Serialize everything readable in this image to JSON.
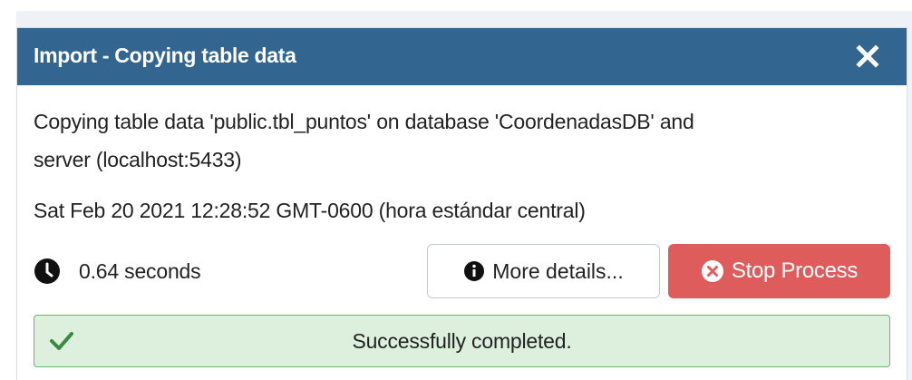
{
  "dialog": {
    "title": "Import - Copying table data",
    "close_icon": "close-icon",
    "header_color": "#326690"
  },
  "message": {
    "line1": "Copying table data 'public.tbl_puntos' on database 'CoordenadasDB' and",
    "line2": "server (localhost:5433)"
  },
  "timestamp": "Sat Feb 20 2021 12:28:52 GMT-0600 (hora estándar central)",
  "timer": {
    "icon": "clock-icon",
    "text": "0.64 seconds"
  },
  "buttons": {
    "details_label": "More details...",
    "details_icon": "info-icon",
    "stop_label": "Stop Process",
    "stop_icon": "stop-circle-icon",
    "stop_color": "#de5c5c"
  },
  "status": {
    "icon": "check-icon",
    "text": "Successfully completed.",
    "color": "#ddf0de"
  }
}
